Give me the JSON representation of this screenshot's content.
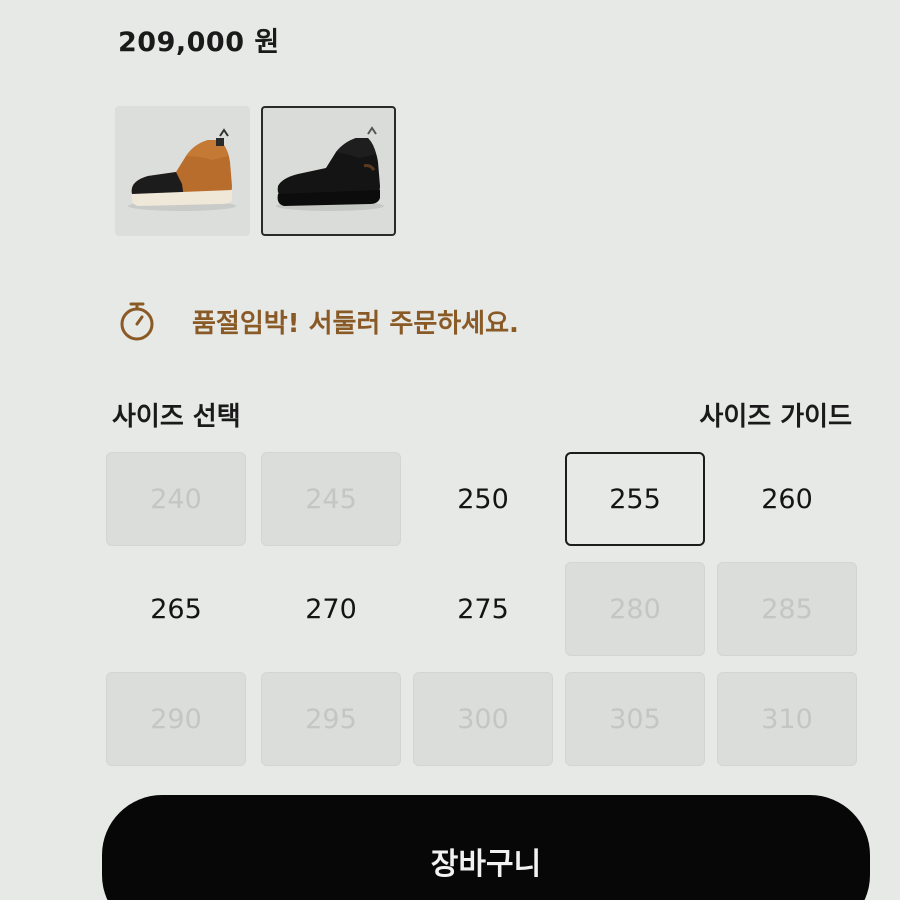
{
  "product": {
    "price": "209,000 원"
  },
  "thumbnails": [
    {
      "name": "brown-black sneaker",
      "selected": false
    },
    {
      "name": "black sneaker",
      "selected": true
    }
  ],
  "stock": {
    "icon": "timer-icon",
    "message": "품절임박! 서둘러 주문하세요."
  },
  "size_section": {
    "label": "사이즈 선택",
    "guide_label": "사이즈 가이드"
  },
  "sizes": [
    {
      "value": "240",
      "available": false
    },
    {
      "value": "245",
      "available": false
    },
    {
      "value": "250",
      "available": true
    },
    {
      "value": "255",
      "available": true,
      "selected": true
    },
    {
      "value": "260",
      "available": true
    },
    {
      "value": "265",
      "available": true
    },
    {
      "value": "270",
      "available": true
    },
    {
      "value": "275",
      "available": true
    },
    {
      "value": "280",
      "available": false
    },
    {
      "value": "285",
      "available": false
    },
    {
      "value": "290",
      "available": false
    },
    {
      "value": "295",
      "available": false
    },
    {
      "value": "300",
      "available": false
    },
    {
      "value": "305",
      "available": false
    },
    {
      "value": "310",
      "available": false
    }
  ],
  "cart": {
    "label": "장바구니"
  },
  "colors": {
    "background": "#e7e9e7",
    "accent": "#8a5a26",
    "button": "#070707"
  }
}
